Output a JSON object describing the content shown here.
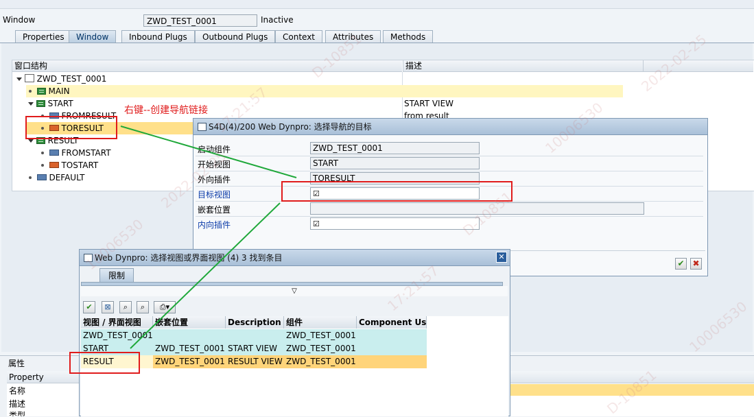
{
  "header": {
    "window_label": "Window",
    "window_name": "ZWD_TEST_0001",
    "status": "Inactive"
  },
  "tabs": [
    {
      "label": "Properties"
    },
    {
      "label": "Window"
    },
    {
      "label": "Inbound Plugs"
    },
    {
      "label": "Outbound Plugs"
    },
    {
      "label": "Context"
    },
    {
      "label": "Attributes"
    },
    {
      "label": "Methods"
    }
  ],
  "tree": {
    "col_structure": "窗口结构",
    "col_desc": "描述",
    "root": "ZWD_TEST_0001",
    "nodes": [
      {
        "label": "MAIN",
        "desc": ""
      },
      {
        "label": "START",
        "desc": "START VIEW"
      },
      {
        "label": "FROMRESULT",
        "desc": "from result"
      },
      {
        "label": "TORESULT",
        "desc": ""
      },
      {
        "label": "RESULT",
        "desc": ""
      },
      {
        "label": "FROMSTART",
        "desc": ""
      },
      {
        "label": "TOSTART",
        "desc": ""
      },
      {
        "label": "DEFAULT",
        "desc": ""
      }
    ]
  },
  "annotation": "右键--创建导航链接",
  "nav_dialog": {
    "title": "S4D(4)/200 Web Dynpro: 选择导航的目标",
    "fields": [
      {
        "label": "启动组件",
        "value": "ZWD_TEST_0001"
      },
      {
        "label": "开始视图",
        "value": "START"
      },
      {
        "label": "外向插件",
        "value": "TORESULT"
      },
      {
        "label": "目标视图",
        "value": ""
      },
      {
        "label": "嵌套位置",
        "value": ""
      },
      {
        "label": "内向插件",
        "value": ""
      }
    ]
  },
  "select_dialog": {
    "title": "Web Dynpro: 选择视图或界面视图 (4)    3 找到条目",
    "tab_label": "限制",
    "columns": [
      "视图 / 界面视图",
      "嵌套位置",
      "Description",
      "组件",
      "Component Use"
    ],
    "rows": [
      [
        "ZWD_TEST_0001",
        "",
        "",
        "ZWD_TEST_0001",
        ""
      ],
      [
        "START",
        "ZWD_TEST_0001",
        "START VIEW",
        "ZWD_TEST_0001",
        ""
      ],
      [
        "RESULT",
        "ZWD_TEST_0001",
        "RESULT VIEW",
        "ZWD_TEST_0001",
        ""
      ]
    ]
  },
  "properties": {
    "section_label": "属性",
    "col_header": "Property",
    "rows": [
      "名称",
      "描述",
      "类型"
    ]
  },
  "watermarks": [
    "10006530",
    "2022-02-25",
    "17:21:57",
    "D-10851"
  ],
  "colors": {
    "accent": "#a9c0d8",
    "selection": "#ffe08a",
    "highlight": "#fff6c0",
    "cyan_row": "#c9eeee",
    "red": "#e01b1b",
    "green": "#1fa83a"
  }
}
